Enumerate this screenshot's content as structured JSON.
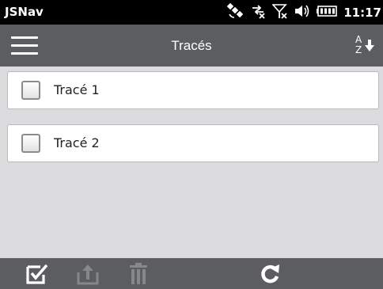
{
  "status_bar": {
    "app_name": "JSNav",
    "time": "11:17",
    "icons": [
      "gps-satellite-icon",
      "data-disconnected-icon",
      "no-signal-icon",
      "volume-icon",
      "battery-icon"
    ]
  },
  "header": {
    "title": "Tracés",
    "menu_icon": "hamburger-menu-icon",
    "sort_icon": "sort-az-icon",
    "sort_letters": [
      "A",
      "Z"
    ]
  },
  "list": {
    "items": [
      {
        "label": "Tracé 1",
        "checked": false
      },
      {
        "label": "Tracé 2",
        "checked": false
      }
    ]
  },
  "toolbar": {
    "buttons": [
      {
        "icon": "select-all-icon",
        "enabled": true
      },
      {
        "icon": "export-icon",
        "enabled": false
      },
      {
        "icon": "delete-icon",
        "enabled": false
      },
      {
        "icon": "refresh-icon",
        "enabled": true
      }
    ]
  },
  "colors": {
    "header_bg": "#5c5d61",
    "status_bg": "#000000",
    "content_bg": "#dcdcdf",
    "disabled_icon": "#86878a"
  }
}
